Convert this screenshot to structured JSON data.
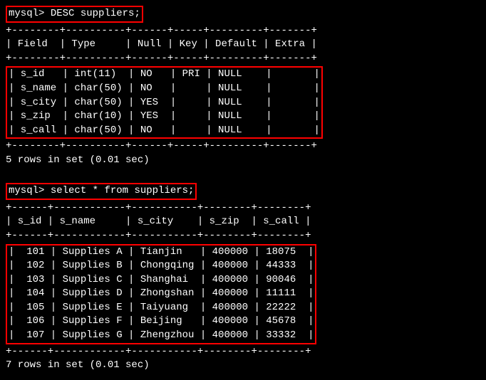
{
  "prompt": "mysql>",
  "query1": {
    "command": "DESC suppliers;",
    "separator_top": "+--------+----------+------+-----+---------+-------+",
    "header_line": "| Field  | Type     | Null | Key | Default | Extra |",
    "separator_mid": "+--------+----------+------+-----+---------+-------+",
    "rows": [
      "| s_id   | int(11)  | NO   | PRI | NULL    |       |",
      "| s_name | char(50) | NO   |     | NULL    |       |",
      "| s_city | char(50) | YES  |     | NULL    |       |",
      "| s_zip  | char(10) | YES  |     | NULL    |       |",
      "| s_call | char(50) | NO   |     | NULL    |       |"
    ],
    "separator_bot": "+--------+----------+------+-----+---------+-------+",
    "footer": "5 rows in set (0.01 sec)",
    "table_data": [
      {
        "Field": "s_id",
        "Type": "int(11)",
        "Null": "NO",
        "Key": "PRI",
        "Default": "NULL",
        "Extra": ""
      },
      {
        "Field": "s_name",
        "Type": "char(50)",
        "Null": "NO",
        "Key": "",
        "Default": "NULL",
        "Extra": ""
      },
      {
        "Field": "s_city",
        "Type": "char(50)",
        "Null": "YES",
        "Key": "",
        "Default": "NULL",
        "Extra": ""
      },
      {
        "Field": "s_zip",
        "Type": "char(10)",
        "Null": "YES",
        "Key": "",
        "Default": "NULL",
        "Extra": ""
      },
      {
        "Field": "s_call",
        "Type": "char(50)",
        "Null": "NO",
        "Key": "",
        "Default": "NULL",
        "Extra": ""
      }
    ]
  },
  "query2": {
    "command": "select * from suppliers;",
    "separator_top": "+------+------------+-----------+--------+--------+",
    "header_line": "| s_id | s_name     | s_city    | s_zip  | s_call |",
    "separator_mid": "+------+------------+-----------+--------+--------+",
    "rows": [
      "|  101 | Supplies A | Tianjin   | 400000 | 18075  |",
      "|  102 | Supplies B | Chongqing | 400000 | 44333  |",
      "|  103 | Supplies C | Shanghai  | 400000 | 90046  |",
      "|  104 | Supplies D | Zhongshan | 400000 | 11111  |",
      "|  105 | Supplies E | Taiyuang  | 400000 | 22222  |",
      "|  106 | Supplies F | Beijing   | 400000 | 45678  |",
      "|  107 | Supplies G | Zhengzhou | 400000 | 33332  |"
    ],
    "separator_bot": "+------+------------+-----------+--------+--------+",
    "footer": "7 rows in set (0.01 sec)",
    "table_data": [
      {
        "s_id": 101,
        "s_name": "Supplies A",
        "s_city": "Tianjin",
        "s_zip": "400000",
        "s_call": "18075"
      },
      {
        "s_id": 102,
        "s_name": "Supplies B",
        "s_city": "Chongqing",
        "s_zip": "400000",
        "s_call": "44333"
      },
      {
        "s_id": 103,
        "s_name": "Supplies C",
        "s_city": "Shanghai",
        "s_zip": "400000",
        "s_call": "90046"
      },
      {
        "s_id": 104,
        "s_name": "Supplies D",
        "s_city": "Zhongshan",
        "s_zip": "400000",
        "s_call": "11111"
      },
      {
        "s_id": 105,
        "s_name": "Supplies E",
        "s_city": "Taiyuang",
        "s_zip": "400000",
        "s_call": "22222"
      },
      {
        "s_id": 106,
        "s_name": "Supplies F",
        "s_city": "Beijing",
        "s_zip": "400000",
        "s_call": "45678"
      },
      {
        "s_id": 107,
        "s_name": "Supplies G",
        "s_city": "Zhengzhou",
        "s_zip": "400000",
        "s_call": "33332"
      }
    ]
  }
}
